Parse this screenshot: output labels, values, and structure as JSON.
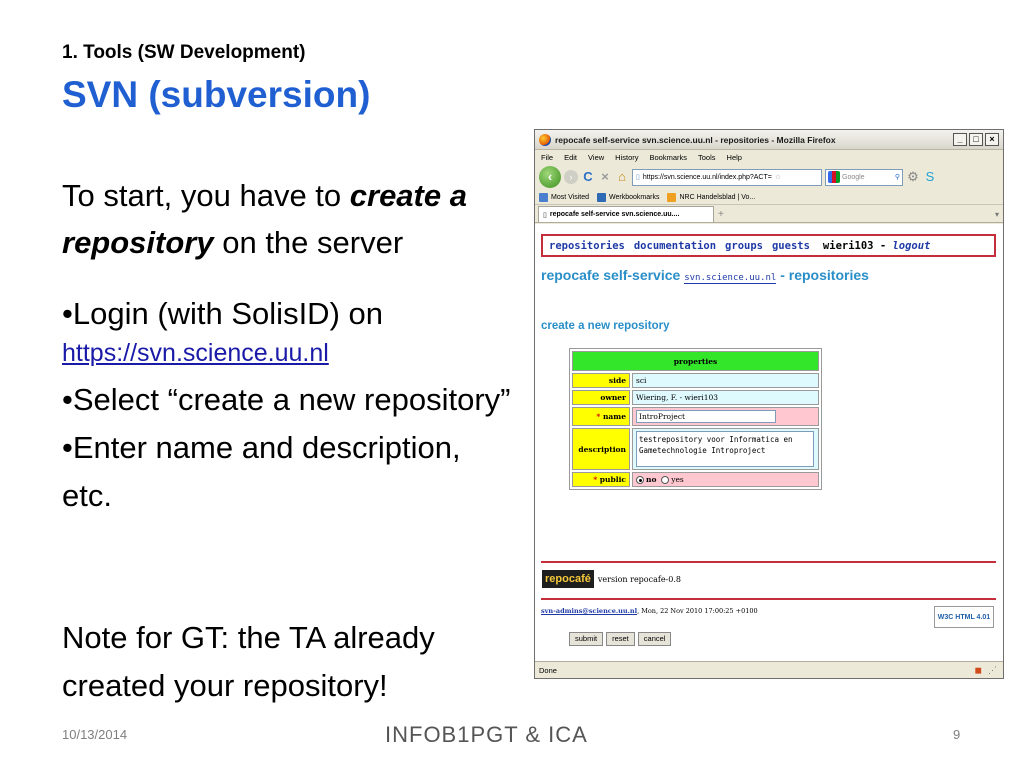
{
  "slide": {
    "subtitle": "1. Tools (SW Development)",
    "title": "SVN (subversion)",
    "intro_prefix": "To start, you have to ",
    "intro_emph": "create a repository",
    "intro_suffix": " on the server",
    "bullets": [
      {
        "text": "•Login (with SolisID) on",
        "link": "https://svn.science.uu.nl"
      },
      {
        "text": "•Select “create a new repository”"
      },
      {
        "text": "•Enter name and description, etc."
      }
    ],
    "note": "Note for GT: the TA already created your repository!",
    "footer_date": "10/13/2014",
    "footer_course": "INFOB1PGT & ICA",
    "page_number": "9"
  },
  "browser": {
    "window_title": "repocafe self-service svn.science.uu.nl - repositories - Mozilla Firefox",
    "menu": [
      "File",
      "Edit",
      "View",
      "History",
      "Bookmarks",
      "Tools",
      "Help"
    ],
    "url": "https://svn.science.uu.nl/index.php?ACT=",
    "search_placeholder": "Google",
    "bookmarks": [
      "Most Visited",
      "Werkbookmarks",
      "NRC Handelsblad | Vo..."
    ],
    "tab_label": "repocafe self-service svn.science.uu....",
    "status": "Done"
  },
  "page": {
    "nav": [
      "repositories",
      "documentation",
      "groups",
      "guests"
    ],
    "user": "wieri103",
    "logout": "logout",
    "heading_prefix": "repocafe self-service",
    "heading_host": "svn.science.uu.nl",
    "heading_suffix": "- repositories",
    "section": "create a new repository",
    "table_header": "properties",
    "fields": {
      "side_label": "side",
      "side_value": "sci",
      "owner_label": "owner",
      "owner_value": "Wiering, F. - wieri103",
      "name_label": "name",
      "name_value": "IntroProject",
      "description_label": "description",
      "description_value": "testrepository voor Informatica en Gametechnologie Introproject",
      "public_label": "public",
      "public_options": [
        "no",
        "yes"
      ],
      "public_selected": "no"
    },
    "buttons": [
      "submit",
      "reset",
      "cancel"
    ],
    "version_logo": "repocafé",
    "version_text": "version repocafe-0.8",
    "admin_email": "svn-admins@science.uu.nl",
    "admin_date": ", Mon, 22 Nov 2010 17:00:25 +0100",
    "w3c_badge": "W3C HTML 4.01"
  }
}
